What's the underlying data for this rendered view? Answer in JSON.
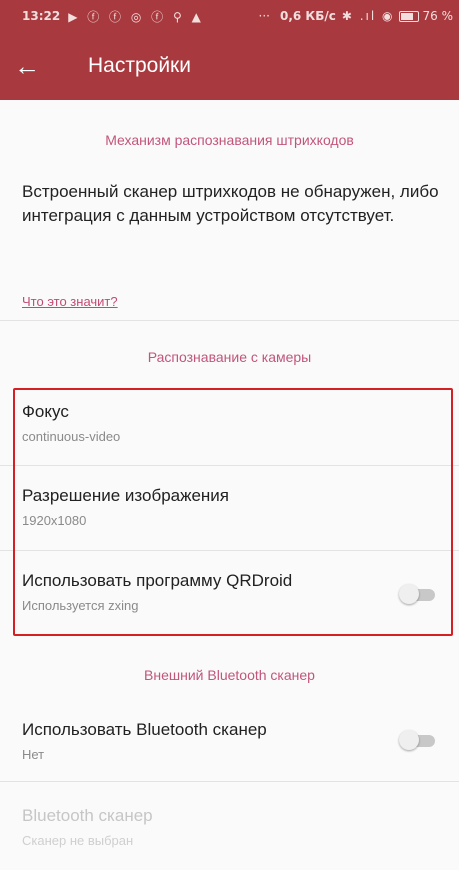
{
  "status_bar": {
    "time": "13:22",
    "notification_icons": "▶ ⓕ ⓕ ◎ ⓕ ⚲ ▲",
    "dots": "···",
    "network_speed": "0,6 КБ/с",
    "signal_icons": "✱ .ıl ◉",
    "battery_percent": "76 %"
  },
  "app_bar": {
    "back_icon": "←",
    "title": "Настройки"
  },
  "sections": {
    "barcode": {
      "header": "Механизм распознавания штрихкодов",
      "message": "Встроенный сканер штрихкодов не обнаружен, либо интеграция с данным устройством отсутствует.",
      "link": "Что это значит?"
    },
    "camera": {
      "header": "Распознавание с камеры",
      "focus_title": "Фокус",
      "focus_value": "continuous-video",
      "resolution_title": "Разрешение изображения",
      "resolution_value": "1920x1080",
      "qrdroid_title": "Использовать программу QRDroid",
      "qrdroid_summary": "Используется zxing",
      "qrdroid_enabled": false
    },
    "bluetooth": {
      "header": "Внешний Bluetooth сканер",
      "use_title": "Использовать Bluetooth сканер",
      "use_summary": "Нет",
      "use_enabled": false,
      "scanner_title": "Bluetooth сканер",
      "scanner_summary": "Сканер не выбран"
    }
  },
  "colors": {
    "primary": "#a83a3f",
    "accent": "#c2557c",
    "highlight_border": "#d41f24"
  }
}
